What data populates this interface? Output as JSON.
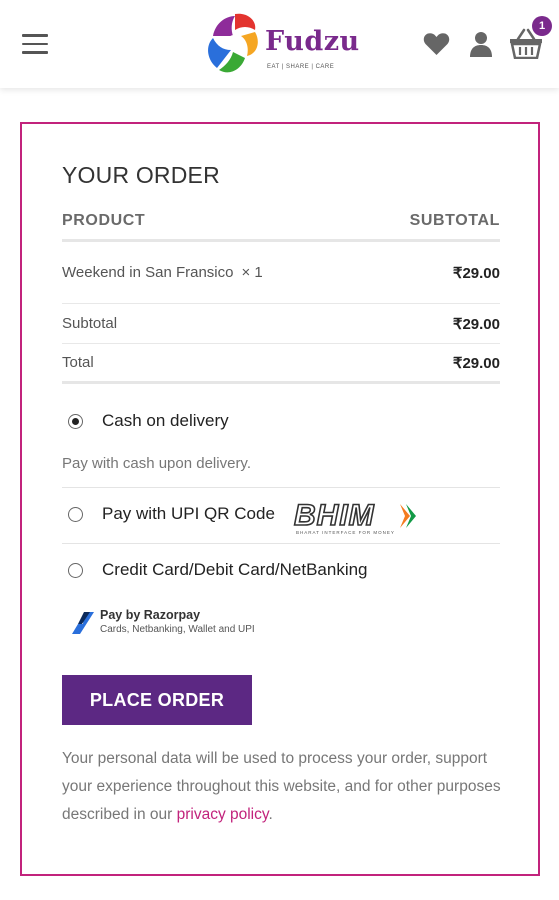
{
  "header": {
    "logo_text": "Fudzu",
    "logo_tagline": "EAT | SHARE | CARE",
    "cart_count": "1",
    "colors": {
      "brand_purple": "#7a2a8c",
      "accent_pink": "#c2237c"
    },
    "icons": [
      "menu-icon",
      "heart-icon",
      "user-icon",
      "basket-icon"
    ]
  },
  "order": {
    "title": "YOUR ORDER",
    "columns": {
      "product": "PRODUCT",
      "subtotal": "SUBTOTAL"
    },
    "items": [
      {
        "name": "Weekend in San Fransico",
        "qty": "× 1",
        "price": "₹29.00"
      }
    ],
    "subtotal_label": "Subtotal",
    "subtotal_value": "₹29.00",
    "total_label": "Total",
    "total_value": "₹29.00"
  },
  "payment": {
    "methods": [
      {
        "label": "Cash on delivery",
        "selected": true
      },
      {
        "label": "Pay with UPI QR Code",
        "selected": false
      },
      {
        "label": "Credit Card/Debit Card/NetBanking",
        "selected": false
      }
    ],
    "cod_description": "Pay with cash upon delivery.",
    "bhim_logo_text": "BHIM",
    "bhim_logo_subtext": "BHARAT INTERFACE FOR MONEY",
    "razorpay_title": "Pay by Razorpay",
    "razorpay_subtitle": "Cards, Netbanking, Wallet and UPI"
  },
  "place_order_label": "PLACE ORDER",
  "privacy": {
    "text": "Your personal data will be used to process your order, support your experience throughout this website, and for other purposes described in our ",
    "link": "privacy policy",
    "end": "."
  },
  "theme": {
    "button_color": "#5c2883",
    "border_color": "#c2237c"
  }
}
